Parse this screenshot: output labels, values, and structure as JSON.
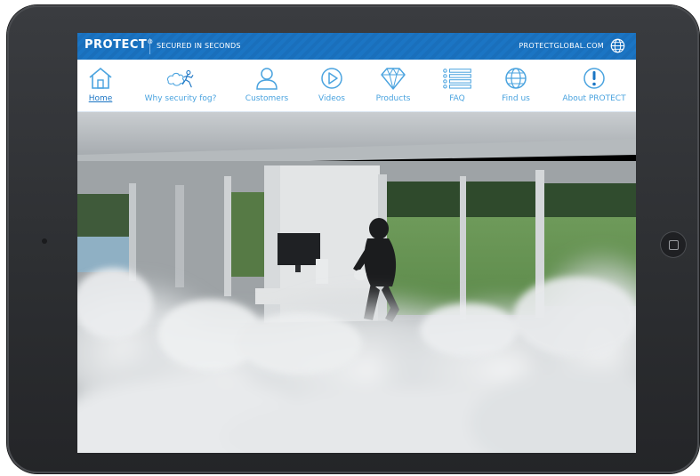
{
  "header": {
    "logo": "PROTECT",
    "logo_mark": "®",
    "tagline": "SECURED IN SECONDS",
    "website": "PROTECTGLOBAL.COM",
    "globe_icon": "globe-icon"
  },
  "nav": {
    "items": [
      {
        "label": "Home",
        "icon": "house-icon",
        "active": true
      },
      {
        "label": "Why security fog?",
        "icon": "running-burglar-icon",
        "active": false
      },
      {
        "label": "Customers",
        "icon": "person-icon",
        "active": false
      },
      {
        "label": "Videos",
        "icon": "play-icon",
        "active": false
      },
      {
        "label": "Products",
        "icon": "diamond-icon",
        "active": false
      },
      {
        "label": "FAQ",
        "icon": "list-icon",
        "active": false
      },
      {
        "label": "Find us",
        "icon": "globe-icon",
        "active": false
      },
      {
        "label": "About PROTECT",
        "icon": "exclamation-icon",
        "active": false
      }
    ]
  },
  "colors": {
    "brand_blue": "#1b75c4",
    "accent_light_blue": "#4aa3df",
    "bezel": "#2c2e31"
  }
}
